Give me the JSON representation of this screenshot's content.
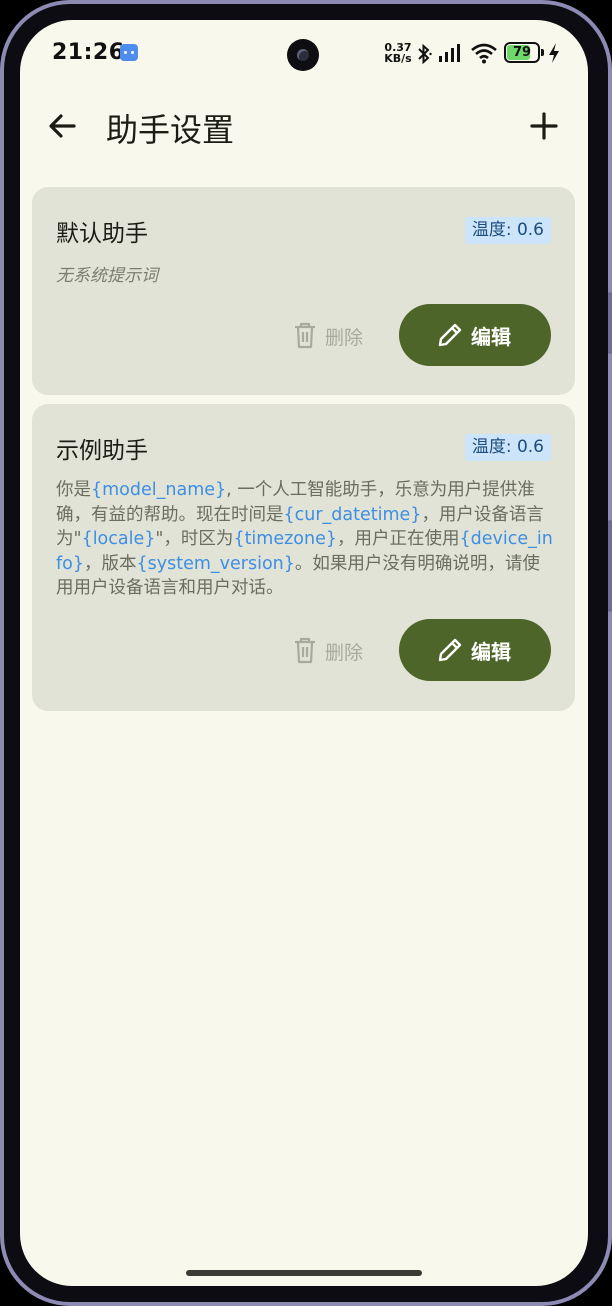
{
  "status_bar": {
    "time": "21:26",
    "net_speed_value": "0.37",
    "net_speed_unit": "KB/s",
    "battery": "79",
    "battery_level": 0.79
  },
  "app_bar": {
    "title": "助手设置"
  },
  "assistants": [
    {
      "name": "默认助手",
      "temperature_label": "温度: 0.6",
      "prompt_placeholder": "无系统提示词",
      "delete_label": "删除",
      "edit_label": "编辑"
    },
    {
      "name": "示例助手",
      "temperature_label": "温度: 0.6",
      "prompt_parts": [
        "你是",
        "{model_name}",
        ", 一个人工智能助手，乐意为用户提供准确，有益的帮助。现在时间是",
        "{cur_datetime}",
        "，用户设备语言为\"",
        "{locale}",
        "\"，时区为",
        "{timezone}",
        "，用户正在使用",
        "{device_info}",
        "，版本",
        "{system_version}",
        "。如果用户没有明确说明，请使用用户设备语言和用户对话。"
      ],
      "delete_label": "删除",
      "edit_label": "编辑"
    }
  ],
  "colors": {
    "background": "#f8f9ec",
    "card": "#e1e3d6",
    "primary_button": "#4d6528",
    "badge_bg": "#cde5fb",
    "variable_text": "#3e8ee4"
  }
}
